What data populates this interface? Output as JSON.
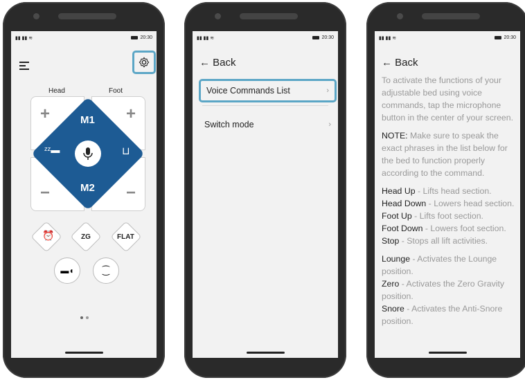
{
  "status": {
    "signal": "ᴰⱏᴰⱏ ≡",
    "time": "20:30"
  },
  "screen1": {
    "head_label": "Head",
    "foot_label": "Foot",
    "m1": "M1",
    "m2": "M2",
    "zg": "ZG",
    "flat": "FLAT",
    "plus": "+",
    "minus": "−"
  },
  "screen2": {
    "back": "← Back",
    "items": [
      {
        "label": "Voice Commands List",
        "chevron": "›"
      },
      {
        "label": "Switch mode",
        "chevron": "›"
      }
    ]
  },
  "screen3": {
    "back": "← Back",
    "intro": "To activate the functions of your adjustable bed using voice commands, tap the microphone button in the center of your screen.",
    "note_label": "NOTE:",
    "note_text": " Make sure to speak the exact phrases in the list below for the bed to function properly according to the command.",
    "commands": [
      {
        "name": "Head Up",
        "desc": " - Lifts head section."
      },
      {
        "name": "Head Down",
        "desc": " - Lowers head section."
      },
      {
        "name": "Foot Up",
        "desc": " - Lifts foot section."
      },
      {
        "name": "Foot Down",
        "desc": " - Lowers foot section."
      },
      {
        "name": "Stop",
        "desc": " - Stops all lift activities."
      }
    ],
    "positions": [
      {
        "name": "Lounge",
        "desc": " - Activates the Lounge position."
      },
      {
        "name": "Zero",
        "desc": " - Activates the Zero Gravity position."
      },
      {
        "name": "Snore",
        "desc": " - Activates the Anti-Snore position."
      }
    ]
  },
  "colors": {
    "accent": "#5ba6c6",
    "brand": "#1d5b94"
  }
}
